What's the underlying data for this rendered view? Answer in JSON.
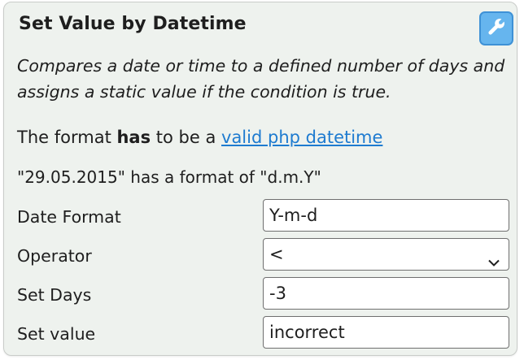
{
  "panel": {
    "title": "Set Value by Datetime",
    "settings_icon": "wrench-icon",
    "description": "Compares a date or time to a defined number of days and assigns a static value if the condition is true.",
    "format_note": {
      "prefix": "The format ",
      "emphasis": "has",
      "middle": " to be a ",
      "link": "valid php datetime"
    },
    "example": "\"29.05.2015\" has a format of \"d.m.Y\""
  },
  "fields": {
    "date_format": {
      "label": "Date Format",
      "value": "Y-m-d"
    },
    "operator": {
      "label": "Operator",
      "value": "<",
      "icon": "chevron-down-icon"
    },
    "set_days": {
      "label": "Set Days",
      "value": "-3"
    },
    "set_value": {
      "label": "Set value",
      "value": "incorrect"
    }
  },
  "colors": {
    "panel_background": "#eef2ee",
    "accent_button": "#66b5ee",
    "link": "#1e7bd0"
  }
}
